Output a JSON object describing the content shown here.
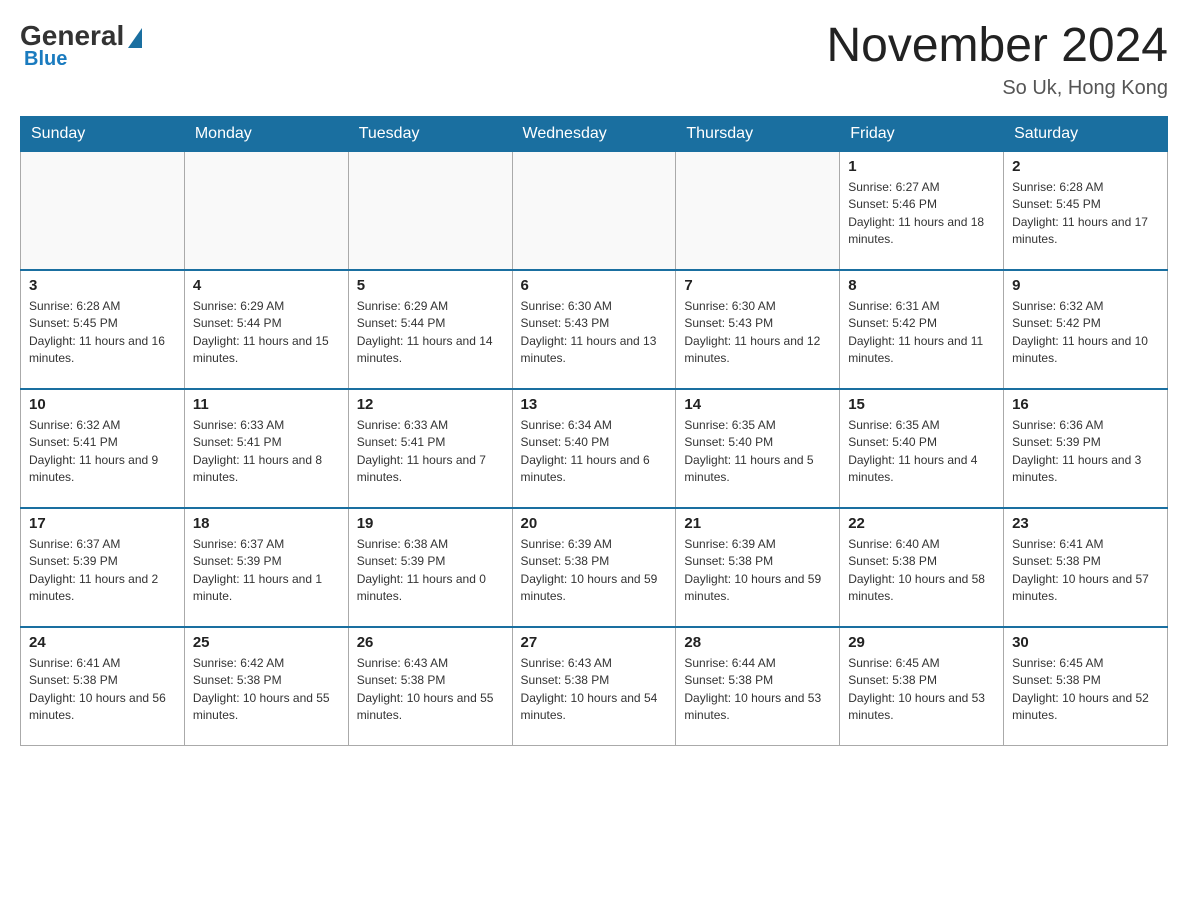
{
  "header": {
    "title": "November 2024",
    "location": "So Uk, Hong Kong",
    "logo_general": "General",
    "logo_blue": "Blue"
  },
  "days_of_week": [
    "Sunday",
    "Monday",
    "Tuesday",
    "Wednesday",
    "Thursday",
    "Friday",
    "Saturday"
  ],
  "weeks": [
    [
      {
        "day": "",
        "empty": true
      },
      {
        "day": "",
        "empty": true
      },
      {
        "day": "",
        "empty": true
      },
      {
        "day": "",
        "empty": true
      },
      {
        "day": "",
        "empty": true
      },
      {
        "day": "1",
        "sunrise": "Sunrise: 6:27 AM",
        "sunset": "Sunset: 5:46 PM",
        "daylight": "Daylight: 11 hours and 18 minutes."
      },
      {
        "day": "2",
        "sunrise": "Sunrise: 6:28 AM",
        "sunset": "Sunset: 5:45 PM",
        "daylight": "Daylight: 11 hours and 17 minutes."
      }
    ],
    [
      {
        "day": "3",
        "sunrise": "Sunrise: 6:28 AM",
        "sunset": "Sunset: 5:45 PM",
        "daylight": "Daylight: 11 hours and 16 minutes."
      },
      {
        "day": "4",
        "sunrise": "Sunrise: 6:29 AM",
        "sunset": "Sunset: 5:44 PM",
        "daylight": "Daylight: 11 hours and 15 minutes."
      },
      {
        "day": "5",
        "sunrise": "Sunrise: 6:29 AM",
        "sunset": "Sunset: 5:44 PM",
        "daylight": "Daylight: 11 hours and 14 minutes."
      },
      {
        "day": "6",
        "sunrise": "Sunrise: 6:30 AM",
        "sunset": "Sunset: 5:43 PM",
        "daylight": "Daylight: 11 hours and 13 minutes."
      },
      {
        "day": "7",
        "sunrise": "Sunrise: 6:30 AM",
        "sunset": "Sunset: 5:43 PM",
        "daylight": "Daylight: 11 hours and 12 minutes."
      },
      {
        "day": "8",
        "sunrise": "Sunrise: 6:31 AM",
        "sunset": "Sunset: 5:42 PM",
        "daylight": "Daylight: 11 hours and 11 minutes."
      },
      {
        "day": "9",
        "sunrise": "Sunrise: 6:32 AM",
        "sunset": "Sunset: 5:42 PM",
        "daylight": "Daylight: 11 hours and 10 minutes."
      }
    ],
    [
      {
        "day": "10",
        "sunrise": "Sunrise: 6:32 AM",
        "sunset": "Sunset: 5:41 PM",
        "daylight": "Daylight: 11 hours and 9 minutes."
      },
      {
        "day": "11",
        "sunrise": "Sunrise: 6:33 AM",
        "sunset": "Sunset: 5:41 PM",
        "daylight": "Daylight: 11 hours and 8 minutes."
      },
      {
        "day": "12",
        "sunrise": "Sunrise: 6:33 AM",
        "sunset": "Sunset: 5:41 PM",
        "daylight": "Daylight: 11 hours and 7 minutes."
      },
      {
        "day": "13",
        "sunrise": "Sunrise: 6:34 AM",
        "sunset": "Sunset: 5:40 PM",
        "daylight": "Daylight: 11 hours and 6 minutes."
      },
      {
        "day": "14",
        "sunrise": "Sunrise: 6:35 AM",
        "sunset": "Sunset: 5:40 PM",
        "daylight": "Daylight: 11 hours and 5 minutes."
      },
      {
        "day": "15",
        "sunrise": "Sunrise: 6:35 AM",
        "sunset": "Sunset: 5:40 PM",
        "daylight": "Daylight: 11 hours and 4 minutes."
      },
      {
        "day": "16",
        "sunrise": "Sunrise: 6:36 AM",
        "sunset": "Sunset: 5:39 PM",
        "daylight": "Daylight: 11 hours and 3 minutes."
      }
    ],
    [
      {
        "day": "17",
        "sunrise": "Sunrise: 6:37 AM",
        "sunset": "Sunset: 5:39 PM",
        "daylight": "Daylight: 11 hours and 2 minutes."
      },
      {
        "day": "18",
        "sunrise": "Sunrise: 6:37 AM",
        "sunset": "Sunset: 5:39 PM",
        "daylight": "Daylight: 11 hours and 1 minute."
      },
      {
        "day": "19",
        "sunrise": "Sunrise: 6:38 AM",
        "sunset": "Sunset: 5:39 PM",
        "daylight": "Daylight: 11 hours and 0 minutes."
      },
      {
        "day": "20",
        "sunrise": "Sunrise: 6:39 AM",
        "sunset": "Sunset: 5:38 PM",
        "daylight": "Daylight: 10 hours and 59 minutes."
      },
      {
        "day": "21",
        "sunrise": "Sunrise: 6:39 AM",
        "sunset": "Sunset: 5:38 PM",
        "daylight": "Daylight: 10 hours and 59 minutes."
      },
      {
        "day": "22",
        "sunrise": "Sunrise: 6:40 AM",
        "sunset": "Sunset: 5:38 PM",
        "daylight": "Daylight: 10 hours and 58 minutes."
      },
      {
        "day": "23",
        "sunrise": "Sunrise: 6:41 AM",
        "sunset": "Sunset: 5:38 PM",
        "daylight": "Daylight: 10 hours and 57 minutes."
      }
    ],
    [
      {
        "day": "24",
        "sunrise": "Sunrise: 6:41 AM",
        "sunset": "Sunset: 5:38 PM",
        "daylight": "Daylight: 10 hours and 56 minutes."
      },
      {
        "day": "25",
        "sunrise": "Sunrise: 6:42 AM",
        "sunset": "Sunset: 5:38 PM",
        "daylight": "Daylight: 10 hours and 55 minutes."
      },
      {
        "day": "26",
        "sunrise": "Sunrise: 6:43 AM",
        "sunset": "Sunset: 5:38 PM",
        "daylight": "Daylight: 10 hours and 55 minutes."
      },
      {
        "day": "27",
        "sunrise": "Sunrise: 6:43 AM",
        "sunset": "Sunset: 5:38 PM",
        "daylight": "Daylight: 10 hours and 54 minutes."
      },
      {
        "day": "28",
        "sunrise": "Sunrise: 6:44 AM",
        "sunset": "Sunset: 5:38 PM",
        "daylight": "Daylight: 10 hours and 53 minutes."
      },
      {
        "day": "29",
        "sunrise": "Sunrise: 6:45 AM",
        "sunset": "Sunset: 5:38 PM",
        "daylight": "Daylight: 10 hours and 53 minutes."
      },
      {
        "day": "30",
        "sunrise": "Sunrise: 6:45 AM",
        "sunset": "Sunset: 5:38 PM",
        "daylight": "Daylight: 10 hours and 52 minutes."
      }
    ]
  ]
}
